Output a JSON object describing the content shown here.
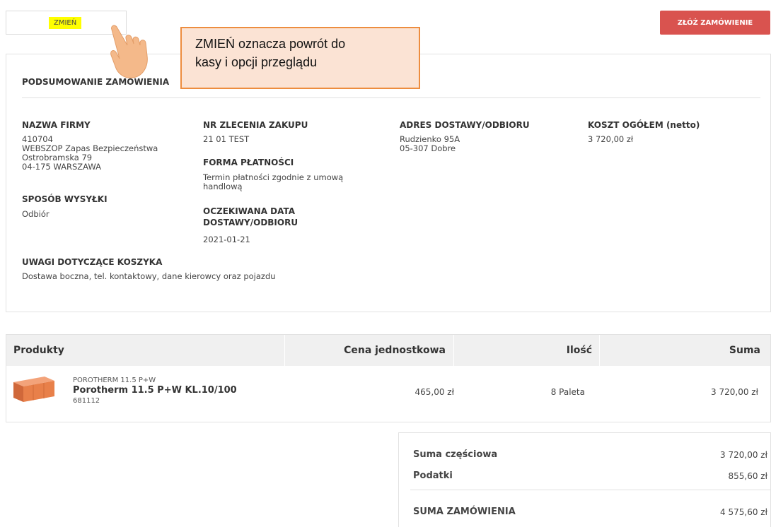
{
  "toolbar": {
    "change_label": "ZMIEŃ",
    "order_label": "ZŁÓŻ ZAMÓWIENIE",
    "order_color": "#d9534f",
    "highlight_color": "#ffff00"
  },
  "annotation": {
    "lines": [
      "ZMIEŃ oznacza powrót do",
      "kasy i opcji przeglądu"
    ],
    "fill_color": "#fbe3d4",
    "border_color": "#ed8d3f",
    "hand_icon": "pointing-hand-icon"
  },
  "summary": {
    "title": "PODSUMOWANIE ZAMÓWIENIA",
    "company": {
      "label": "NAZWA FIRMY",
      "lines": [
        "410704",
        "WEBSZOP Zapas Bezpieczeństwa",
        "Ostrobramska 79",
        "04-175 WARSZAWA"
      ]
    },
    "shipping_method": {
      "label": "SPOSÓB WYSYŁKI",
      "value": "Odbiór"
    },
    "po_number": {
      "label": "NR ZLECENIA ZAKUPU",
      "value": "21 01 TEST"
    },
    "payment": {
      "label": "FORMA PŁATNOŚCI",
      "lines": [
        "Termin płatności zgodnie z umową",
        "handlową"
      ]
    },
    "expected_date": {
      "label_lines": [
        "OCZEKIWANA DATA",
        "DOSTAWY/ODBIORU"
      ],
      "value": "2021-01-21"
    },
    "address": {
      "label": "ADRES DOSTAWY/ODBIORU",
      "lines": [
        "Rudzienko 95A",
        "05-307 Dobre"
      ]
    },
    "total_cost": {
      "label": "KOSZT OGÓŁEM (netto)",
      "value": "3 720,00 zł"
    },
    "cart_notes": {
      "label": "UWAGI DOTYCZĄCE KOSZYKA",
      "value": "Dostawa boczna, tel. kontaktowy, dane kierowcy oraz pojazdu"
    }
  },
  "products": {
    "headers": [
      "Produkty",
      "Cena jednostkowa",
      "Ilość",
      "Suma"
    ],
    "items": [
      {
        "brand": "POROTHERM 11.5 P+W",
        "name": "Porotherm 11.5 P+W KL.10/100",
        "code": "681112",
        "unit_price": "465,00 zł",
        "quantity": "8 Paleta",
        "sum": "3 720,00 zł",
        "image_icon": "brick-icon",
        "image_color": "#e8804a"
      }
    ]
  },
  "totals": {
    "subtotal_label": "Suma częściowa",
    "subtotal_value": "3 720,00 zł",
    "tax_label": "Podatki",
    "tax_value": "855,60 zł",
    "order_total_label": "SUMA ZAMÓWIENIA",
    "order_total_value": "4 575,60 zł"
  }
}
